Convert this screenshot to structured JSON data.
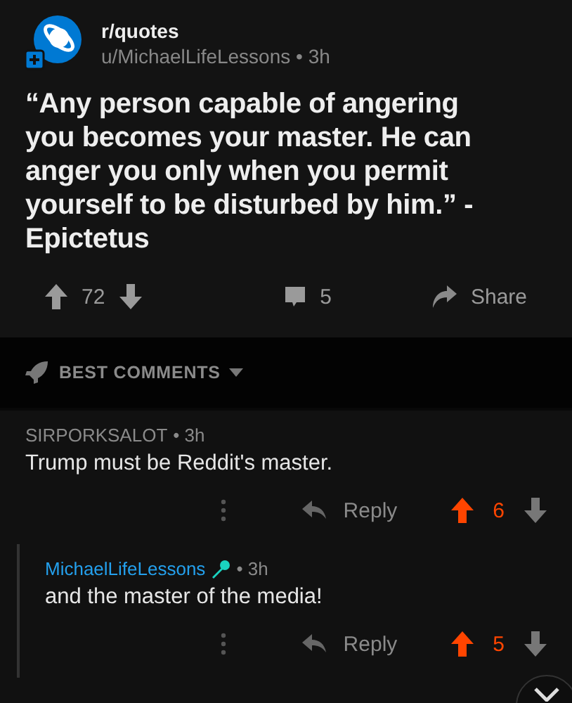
{
  "post": {
    "subreddit": "r/quotes",
    "author": "u/MichaelLifeLessons",
    "time": "• 3h",
    "title": "“Any person capable of angering you becomes your master. He can anger you only when you permit yourself to be disturbed by him.” - Epictetus",
    "score": "72",
    "upvoted": false,
    "comments": "5",
    "share": "Share"
  },
  "sort": {
    "label": "BEST COMMENTS"
  },
  "comments": [
    {
      "author": "SIRPORKSALOT",
      "op": false,
      "time": "• 3h",
      "body": "Trump must be Reddit's master.",
      "reply": "Reply",
      "score": "6",
      "upvoted": true,
      "children": [
        {
          "author": "MichaelLifeLessons",
          "op": true,
          "time": "• 3h",
          "body": "and the master of the media!",
          "reply": "Reply",
          "score": "5",
          "upvoted": true
        }
      ]
    }
  ]
}
